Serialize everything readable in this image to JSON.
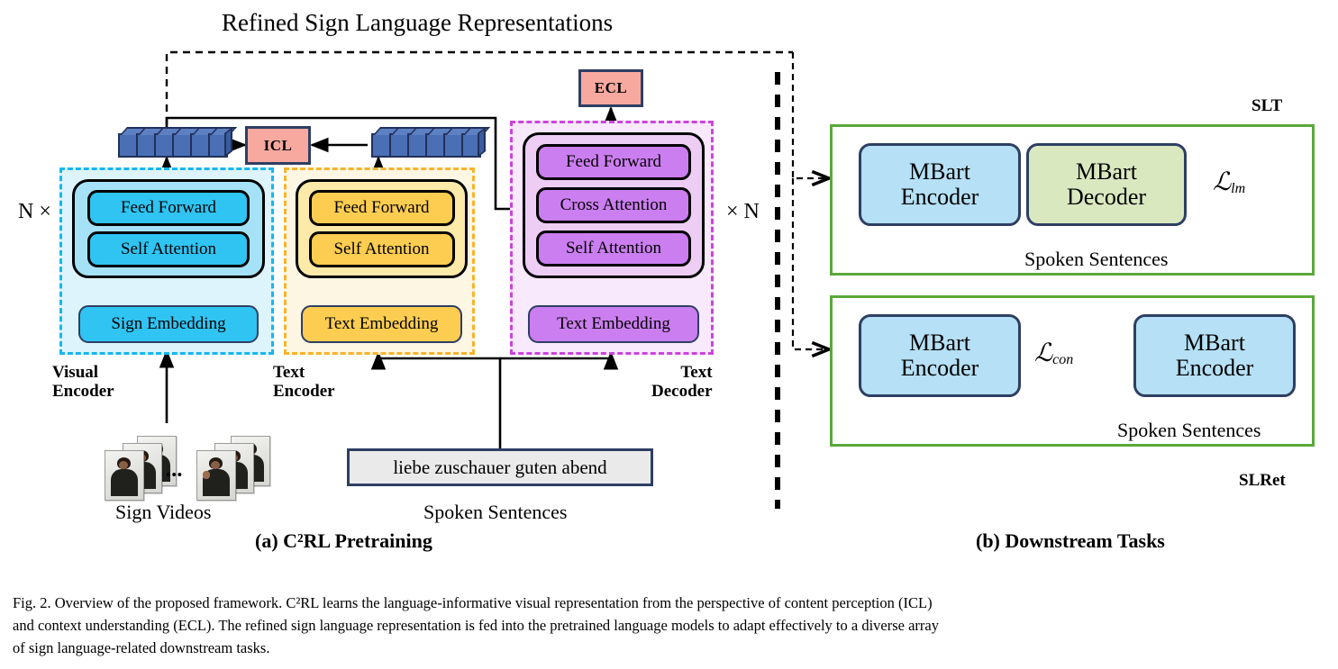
{
  "figure": {
    "top_title": "Refined Sign Language Representations",
    "panel_a_title": "(a) C²RL Pretraining",
    "panel_b_title": "(b) Downstream Tasks"
  },
  "pretraining": {
    "repeat_left": "N ×",
    "repeat_right": "× N",
    "visual_encoder": {
      "label_line1": "Visual",
      "label_line2": "Encoder",
      "ops": [
        "Feed Forward",
        "Self Attention"
      ],
      "embedding": "Sign Embedding",
      "dash_color": "#17b6f0",
      "fill_color": "#ddf4fd",
      "inner_color": "#a5e2f7",
      "op_color": "#2fc4f2"
    },
    "text_encoder": {
      "label_line1": "Text",
      "label_line2": "Encoder",
      "ops": [
        "Feed Forward",
        "Self Attention"
      ],
      "embedding": "Text Embedding",
      "dash_color": "#f7b32b",
      "fill_color": "#fdf6e3",
      "inner_color": "#fde9a8",
      "op_color": "#fccd50"
    },
    "text_decoder": {
      "label_line1": "Text",
      "label_line2": "Decoder",
      "ops": [
        "Feed Forward",
        "Cross Attention",
        "Self Attention"
      ],
      "embedding": "Text Embedding",
      "dash_color": "#cc44dd",
      "fill_color": "#f8e9fc",
      "inner_color": "#eecdf5",
      "op_color": "#cb7ef0"
    },
    "losses": {
      "icl": "ICL",
      "ecl": "ECL",
      "color": "#f7a9a0"
    },
    "inputs": {
      "sign_videos_label": "Sign Videos",
      "sign_videos_ellipsis": "• • •",
      "spoken_sentence_value": "liebe zuschauer guten abend",
      "spoken_sentences_label": "Spoken Sentences"
    },
    "token_blocks": 6
  },
  "downstream": {
    "slt": {
      "badge": "SLT",
      "encoder": {
        "line1": "MBart",
        "line2": "Encoder"
      },
      "decoder": {
        "line1": "MBart",
        "line2": "Decoder"
      },
      "loss_symbol": "ℒ",
      "loss_sub": "lm",
      "input_label": "Spoken Sentences"
    },
    "slret": {
      "badge": "SLRet",
      "encoder_left": {
        "line1": "MBart",
        "line2": "Encoder"
      },
      "encoder_right": {
        "line1": "MBart",
        "line2": "Encoder"
      },
      "loss_symbol": "ℒ",
      "loss_sub": "con",
      "input_label": "Spoken Sentences"
    },
    "panel_border_color": "#5aa83a"
  },
  "caption": {
    "line1": "Fig. 2.  Overview of the proposed framework. C²RL learns the language-informative visual representation from the perspective of content perception (ICL)",
    "line2": "and context understanding (ECL). The refined sign language representation is fed into the pretrained language models to adapt effectively to a diverse array",
    "line3": "of sign language-related downstream tasks."
  }
}
